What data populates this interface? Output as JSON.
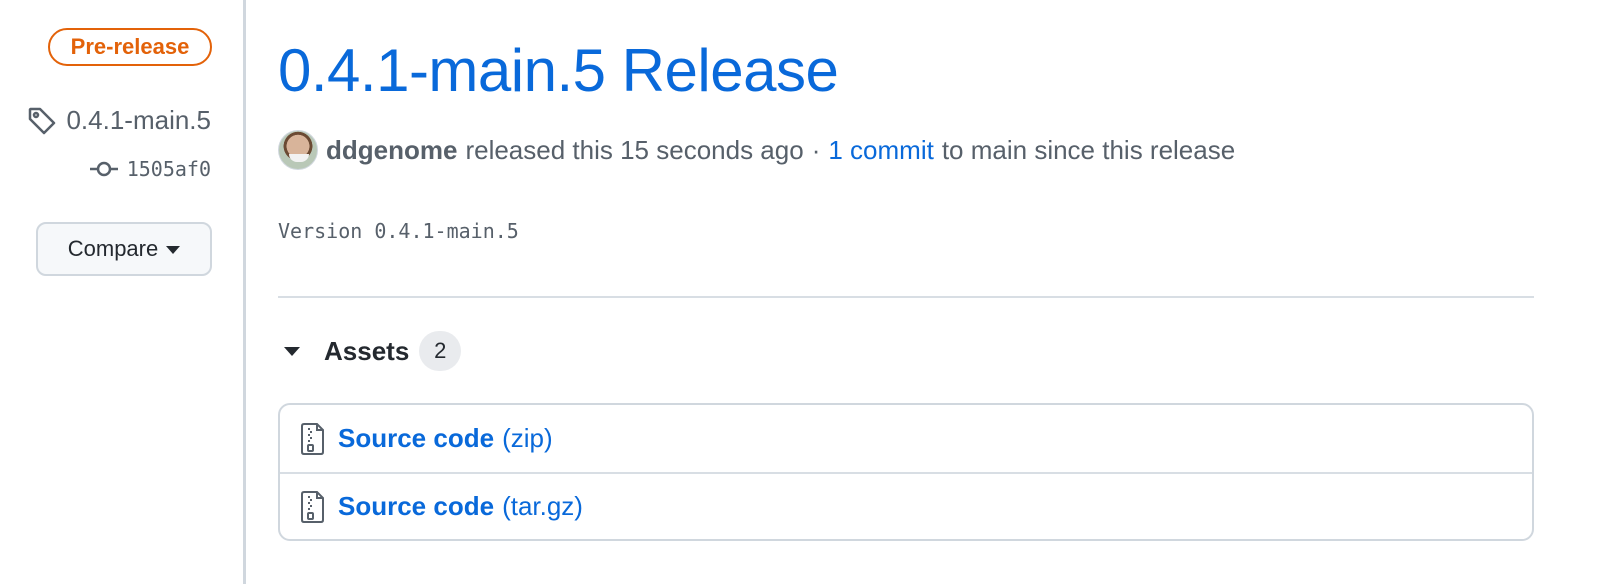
{
  "sidebar": {
    "badge": "Pre-release",
    "tag": "0.4.1-main.5",
    "commit": "1505af0",
    "compare_label": "Compare"
  },
  "release": {
    "title": "0.4.1-main.5 Release",
    "author": "ddgenome",
    "released_text": "released this 15 seconds ago",
    "separator": "·",
    "commit_link": "1 commit",
    "commit_suffix": "to main since this release",
    "body": "Version 0.4.1-main.5"
  },
  "assets": {
    "title": "Assets",
    "count": "2",
    "items": [
      {
        "name": "Source code",
        "format": "(zip)"
      },
      {
        "name": "Source code",
        "format": "(tar.gz)"
      }
    ]
  },
  "colors": {
    "link": "#0969da",
    "prerelease": "#e36209",
    "muted": "#57606a",
    "border": "#d0d7de"
  },
  "icons": [
    "tag-icon",
    "git-commit-icon",
    "caret-down-icon",
    "triangle-down-icon",
    "file-zip-icon",
    "avatar"
  ]
}
